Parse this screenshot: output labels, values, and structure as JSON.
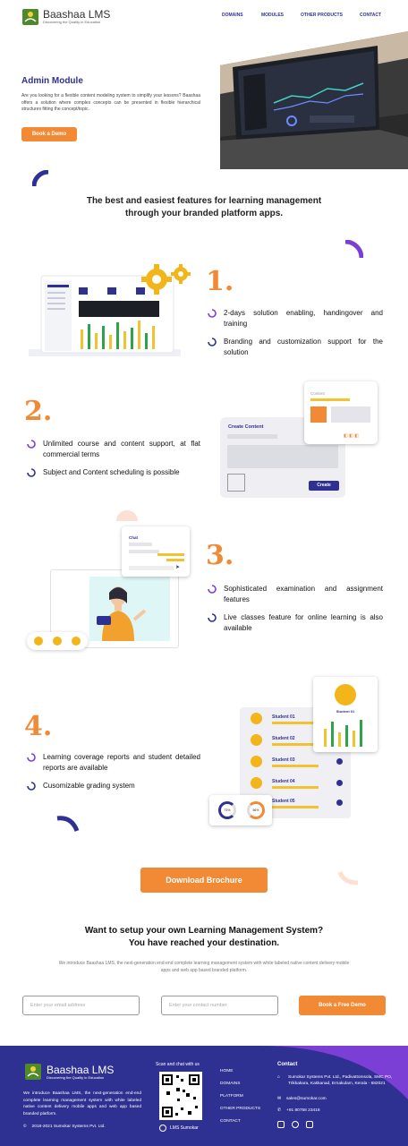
{
  "header": {
    "logo_title": "Baashaa LMS",
    "logo_tagline": "Discovering the Quality in Education",
    "nav": [
      "DOMAINS",
      "MODULES",
      "OTHER PRODUCTS",
      "CONTACT"
    ]
  },
  "hero": {
    "title": "Admin Module",
    "description": "Are you looking for a flexible content modeling system to simplify your lessons? Baashaa offers a solution where complex concepts can be presented in flexible hierarchical structures fitting the concept/topic.",
    "cta": "Book a Demo"
  },
  "features_heading": "The best and easiest features for learning management through your branded platform apps.",
  "features": [
    {
      "number": "1.",
      "items": [
        "2-days solution enabling, handingover and training",
        "Branding and customization support for the solution"
      ]
    },
    {
      "number": "2.",
      "items": [
        "Unlimited course and content support, at flat commercial terms",
        "Subject and Content scheduling is possible"
      ],
      "illustration": {
        "card_title": "Create Content",
        "card_small": "Content",
        "button": "Create"
      }
    },
    {
      "number": "3.",
      "items": [
        "Sophisticated examination and assignment features",
        "Live classes feature for online learning is also available"
      ],
      "illustration": {
        "chat_title": "Chat"
      }
    },
    {
      "number": "4.",
      "items": [
        "Learning coverage reports and student detailed reports are available",
        "Cusomizable grading system"
      ],
      "illustration": {
        "students": [
          "Student 01",
          "Student 02",
          "Student 03",
          "Student 04",
          "Student 05"
        ],
        "highlight": "Student 01",
        "donut_a": "73%",
        "donut_b": "56%"
      }
    }
  ],
  "download_brochure": "Download Brochure",
  "cta": {
    "title_line1": "Want to setup your own Learning Management System?",
    "title_line2": "You have reached your destination.",
    "description": "We introduce Baashaa LMS, the next-generation end-end complete learning management system with white labeled native content delivery mobile apps and web app based branded platform.",
    "email_placeholder": "Enter your email address",
    "phone_placeholder": "Enter your contact number",
    "button": "Book a Free Demo"
  },
  "footer": {
    "logo_title": "Baashaa LMS",
    "logo_tagline": "Discovering the Quality in Education",
    "about": "We introduce Baashaa LMS, the next-generation end-end complete learning management system with white labeled native content delivery mobile apps and web app based branded platform.",
    "copyright": "2018-2021 Sumokar Systems Pvt. Ltd.",
    "scan_label": "Scan and chat with us",
    "whatsapp_label": "LMS Sumokar",
    "links": [
      "HOME",
      "DOMAINS",
      "PLATFORM",
      "OTHER PRODUCTS",
      "CONTACT"
    ],
    "contact_title": "Contact",
    "address": "Sumokar Systems Pvt. Ltd., Padivattomsola, SMC PO, Trikkakara, Kakkanad, Ernakulam, Kerala - 682021",
    "email": "sales@sumokar.com",
    "phone": "+91 80758 23418"
  },
  "colors": {
    "primary": "#2f3192",
    "accent": "#f28a35",
    "purple": "#7b3fd6"
  }
}
